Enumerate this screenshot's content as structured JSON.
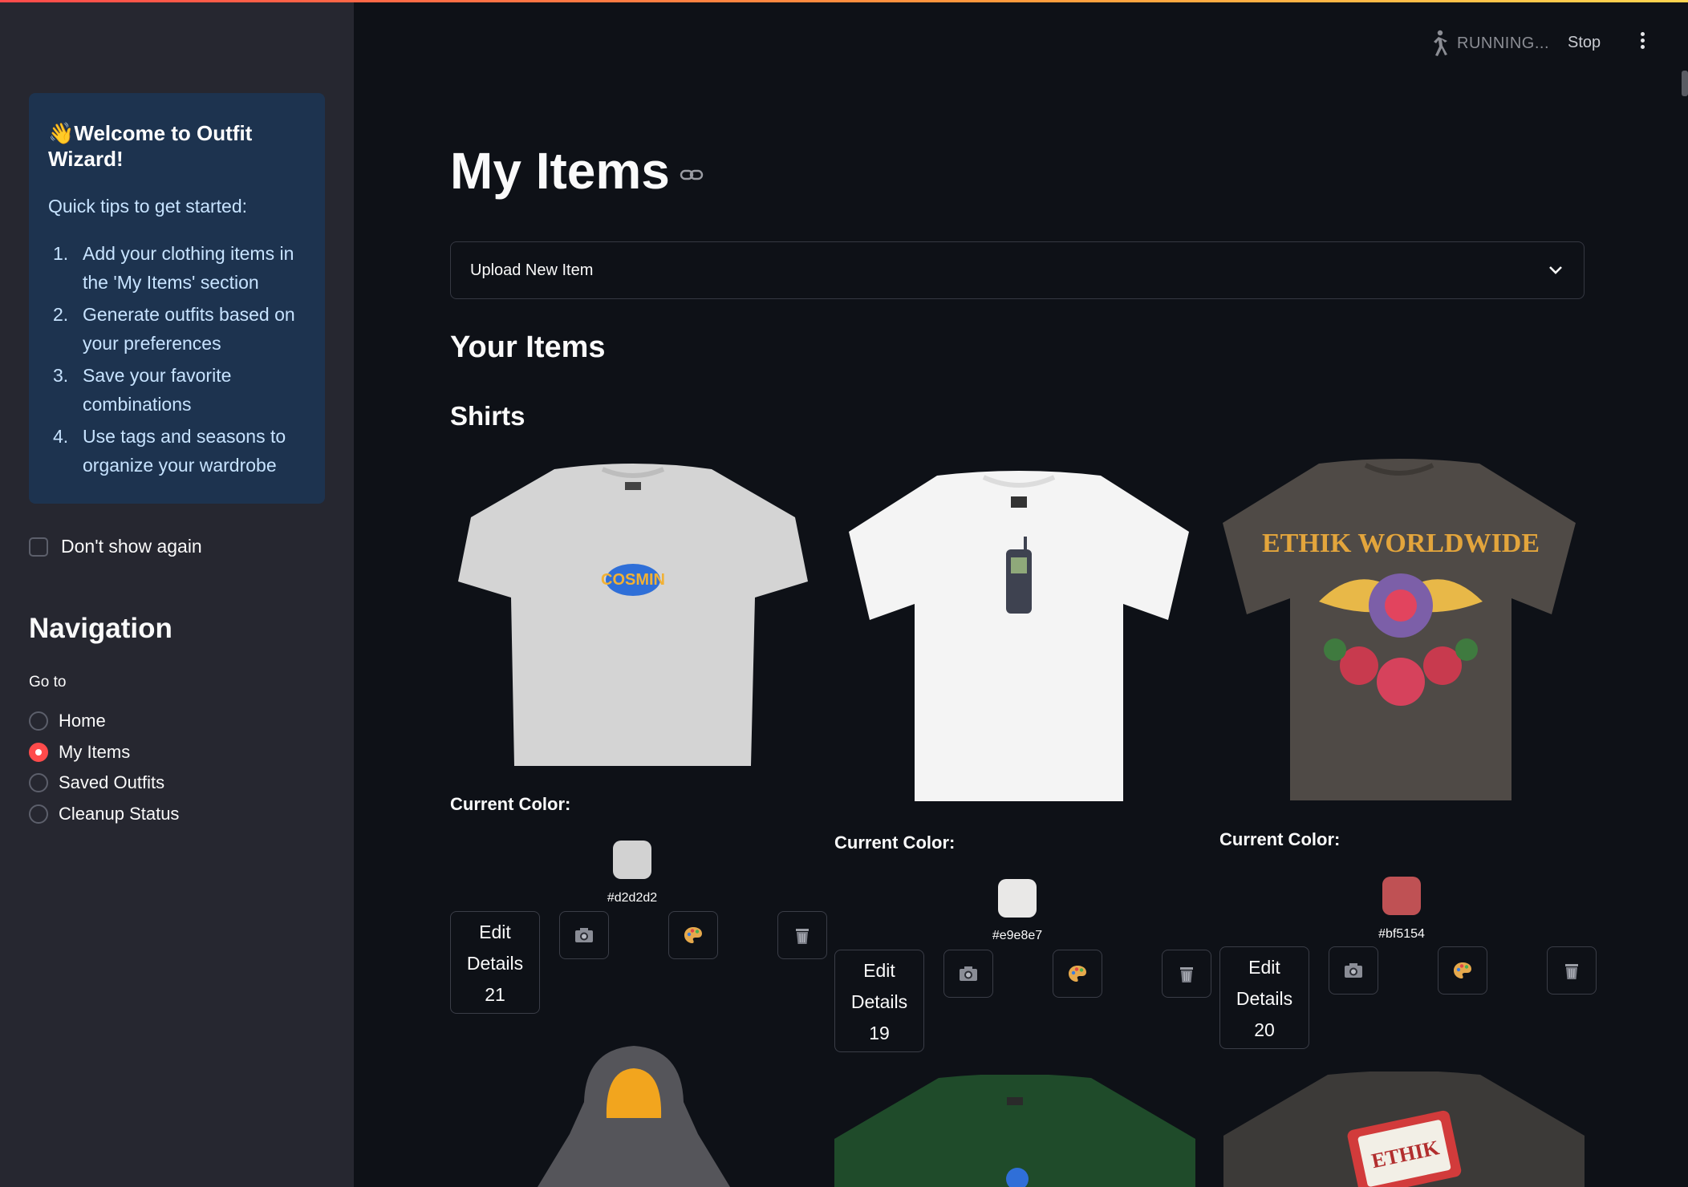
{
  "header": {
    "status_text": "RUNNING...",
    "stop_label": "Stop"
  },
  "sidebar": {
    "welcome": {
      "emoji": "👋",
      "title": "Welcome to Outfit Wizard!",
      "subtitle": "Quick tips to get started:",
      "tips": [
        {
          "num": "1.",
          "text": "Add your clothing items in the 'My Items' section"
        },
        {
          "num": "2.",
          "text": "Generate outfits based on your preferences"
        },
        {
          "num": "3.",
          "text": "Save your favorite combinations"
        },
        {
          "num": "4.",
          "text": "Use tags and seasons to organize your wardrobe"
        }
      ]
    },
    "dont_show_label": "Don't show again",
    "dont_show_checked": false,
    "nav_title": "Navigation",
    "goto_label": "Go to",
    "nav_items": [
      {
        "label": "Home",
        "selected": false
      },
      {
        "label": "My Items",
        "selected": true
      },
      {
        "label": "Saved Outfits",
        "selected": false
      },
      {
        "label": "Cleanup Status",
        "selected": false
      }
    ]
  },
  "main": {
    "title": "My Items",
    "upload_expander_label": "Upload New Item",
    "section_title": "Your Items",
    "category_title": "Shirts",
    "items": [
      {
        "color_label": "Current Color:",
        "color_hex": "#d2d2d2",
        "edit_line1": "Edit",
        "edit_line2": "Details",
        "edit_line3": "21",
        "icons": [
          "camera-icon",
          "palette-icon",
          "trash-icon"
        ]
      },
      {
        "color_label": "Current Color:",
        "color_hex": "#e9e8e7",
        "edit_line1": "Edit",
        "edit_line2": "Details",
        "edit_line3": "19",
        "icons": [
          "camera-icon",
          "palette-icon",
          "trash-icon"
        ]
      },
      {
        "color_label": "Current Color:",
        "color_hex": "#bf5154",
        "edit_line1": "Edit",
        "edit_line2": "Details",
        "edit_line3": "20",
        "icons": [
          "camera-icon",
          "palette-icon",
          "trash-icon"
        ]
      }
    ],
    "shirt_prints": [
      "COSMIN",
      "ETHIK WORLDWIDE",
      "ETHIK"
    ]
  },
  "colors": {
    "accent": "#ff4b4b",
    "sidebar_bg": "#262730",
    "main_bg": "#0e1117",
    "info_box_bg": "#1d334f"
  }
}
